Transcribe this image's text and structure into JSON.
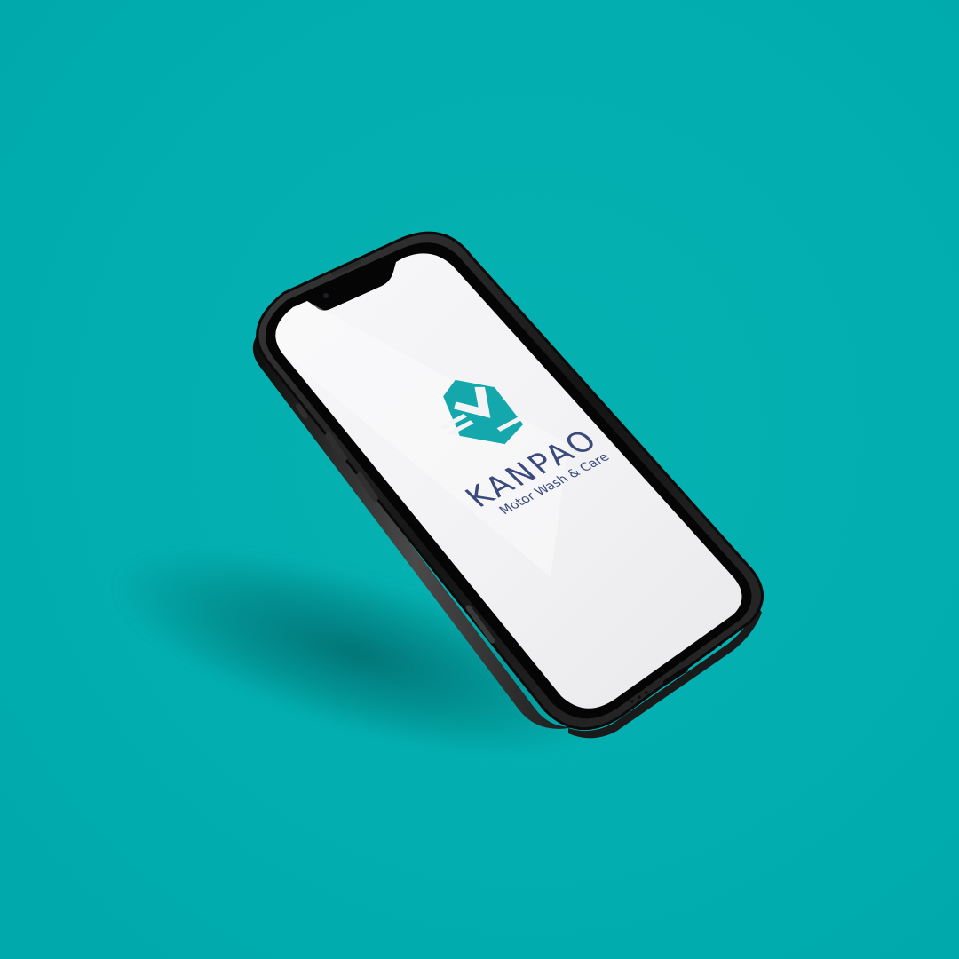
{
  "scene": {
    "background_color": "#02aeb0",
    "phone_frame_color": "#1a1a1a",
    "screen_color": "#f4f4f6"
  },
  "brand": {
    "name": "KANPAO",
    "tagline": "Motor Wash & Care",
    "logo_icon": "kanpao-logo-icon",
    "primary_color": "#14a8ad",
    "text_color": "#3a4a7a"
  }
}
